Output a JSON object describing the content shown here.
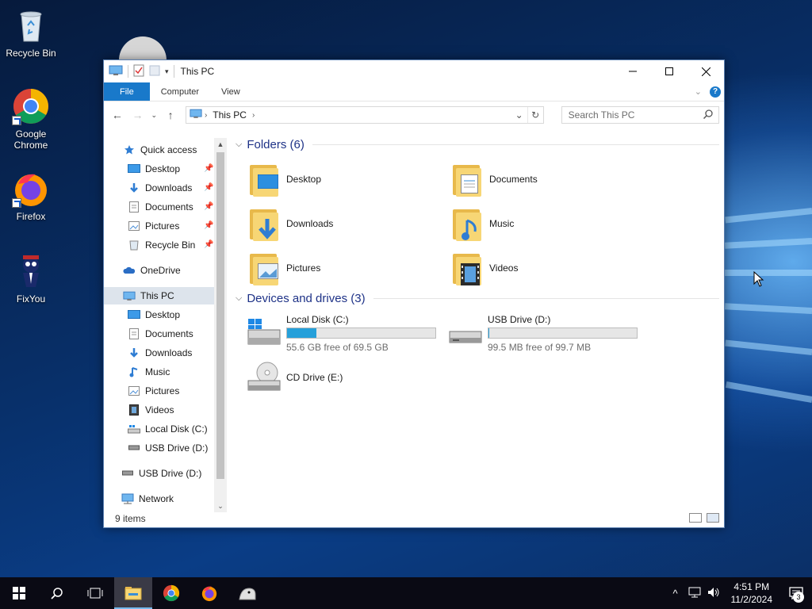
{
  "desktop": {
    "icons": [
      {
        "label": "Recycle Bin",
        "icon": "recycle-bin-icon"
      },
      {
        "label": "Google Chrome",
        "icon": "chrome-icon"
      },
      {
        "label": "Firefox",
        "icon": "firefox-icon"
      },
      {
        "label": "FixYou",
        "icon": "fixyou-icon"
      }
    ]
  },
  "window": {
    "title": "This PC",
    "ribbon_tabs": [
      "File",
      "Computer",
      "View"
    ],
    "address": {
      "crumbs": [
        "This PC"
      ]
    },
    "search": {
      "placeholder": "Search This PC"
    }
  },
  "nav": {
    "items": [
      {
        "label": "Quick access",
        "icon": "star-icon"
      },
      {
        "label": "Desktop",
        "icon": "desktop-icon",
        "pinned": true
      },
      {
        "label": "Downloads",
        "icon": "download-icon",
        "pinned": true
      },
      {
        "label": "Documents",
        "icon": "documents-icon",
        "pinned": true
      },
      {
        "label": "Pictures",
        "icon": "pictures-icon",
        "pinned": true
      },
      {
        "label": "Recycle Bin",
        "icon": "recycle-bin-icon",
        "pinned": true
      },
      {
        "label": "OneDrive",
        "icon": "cloud-icon"
      },
      {
        "label": "This PC",
        "icon": "computer-icon",
        "selected": true
      },
      {
        "label": "Desktop",
        "icon": "desktop-icon"
      },
      {
        "label": "Documents",
        "icon": "documents-icon"
      },
      {
        "label": "Downloads",
        "icon": "download-icon"
      },
      {
        "label": "Music",
        "icon": "music-icon"
      },
      {
        "label": "Pictures",
        "icon": "pictures-icon"
      },
      {
        "label": "Videos",
        "icon": "videos-icon"
      },
      {
        "label": "Local Disk (C:)",
        "icon": "drive-icon"
      },
      {
        "label": "USB Drive (D:)",
        "icon": "usb-drive-icon"
      },
      {
        "label": "USB Drive (D:)",
        "icon": "usb-drive-icon"
      },
      {
        "label": "Network",
        "icon": "network-icon"
      }
    ]
  },
  "content": {
    "folders_header": "Folders (6)",
    "folders": [
      {
        "label": "Desktop",
        "icon": "desktop-folder-icon"
      },
      {
        "label": "Documents",
        "icon": "documents-folder-icon"
      },
      {
        "label": "Downloads",
        "icon": "downloads-folder-icon"
      },
      {
        "label": "Music",
        "icon": "music-folder-icon"
      },
      {
        "label": "Pictures",
        "icon": "pictures-folder-icon"
      },
      {
        "label": "Videos",
        "icon": "videos-folder-icon"
      }
    ],
    "drives_header": "Devices and drives (3)",
    "drives": [
      {
        "label": "Local Disk (C:)",
        "free": "55.6 GB free of 69.5 GB",
        "used_fraction": 0.2
      },
      {
        "label": "USB Drive (D:)",
        "free": "99.5 MB free of 99.7 MB",
        "used_fraction": 0.002
      },
      {
        "label": "CD Drive (E:)",
        "free": "",
        "used_fraction": null
      }
    ]
  },
  "status": {
    "items": "9 items"
  },
  "taskbar": {
    "time": "4:51 PM",
    "date": "11/2/2024",
    "notifications": "3"
  },
  "colors": {
    "accent": "#1979ca",
    "drive_fill": "#26a0da",
    "header": "#1e3287"
  }
}
